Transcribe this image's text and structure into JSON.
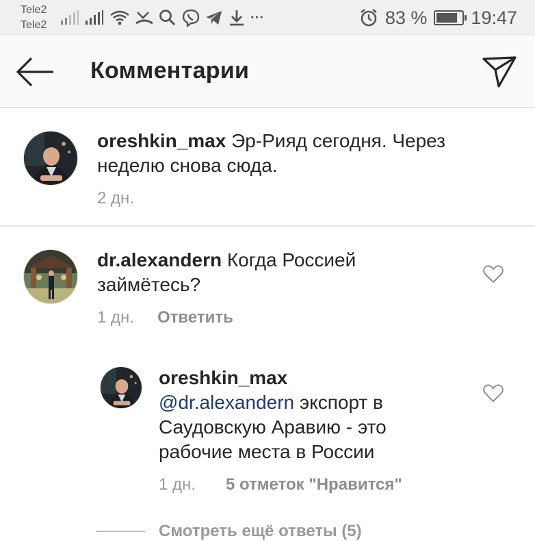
{
  "status_bar": {
    "carrier_1": "Tele2",
    "carrier_2": "Tele2",
    "icons": [
      "signal-icon",
      "signal-icon",
      "wifi-icon",
      "missed-call-icon",
      "search-icon",
      "viber-icon",
      "telegram-icon",
      "download-icon",
      "more-icon"
    ],
    "more": "···",
    "alarm_icon": "alarm-icon",
    "battery_percent": "83 %",
    "battery_level": 0.83,
    "time": "19:47"
  },
  "header": {
    "title": "Комментарии",
    "back_icon": "arrow-left-icon",
    "share_icon": "send-icon"
  },
  "caption": {
    "username": "oreshkin_max",
    "text": " Эр-Рияд сегодня. Через неделю снова сюда.",
    "time": "2 дн."
  },
  "comments": [
    {
      "username": "dr.alexandern",
      "text": " Когда Россией займётесь?",
      "time": "1 дн.",
      "reply_label": "Ответить"
    }
  ],
  "reply": {
    "username": "oreshkin_max",
    "mention": "@dr.alexandern",
    "text": " экспорт в Саудовскую Аравию - это рабочие места в России",
    "time": "1 дн.",
    "likes_label": "5 отметок \"Нравится\""
  },
  "view_replies": "Смотреть ещё ответы (5)",
  "colors": {
    "mention": "#1e3a6e",
    "text": "#262626",
    "muted": "#999999"
  }
}
